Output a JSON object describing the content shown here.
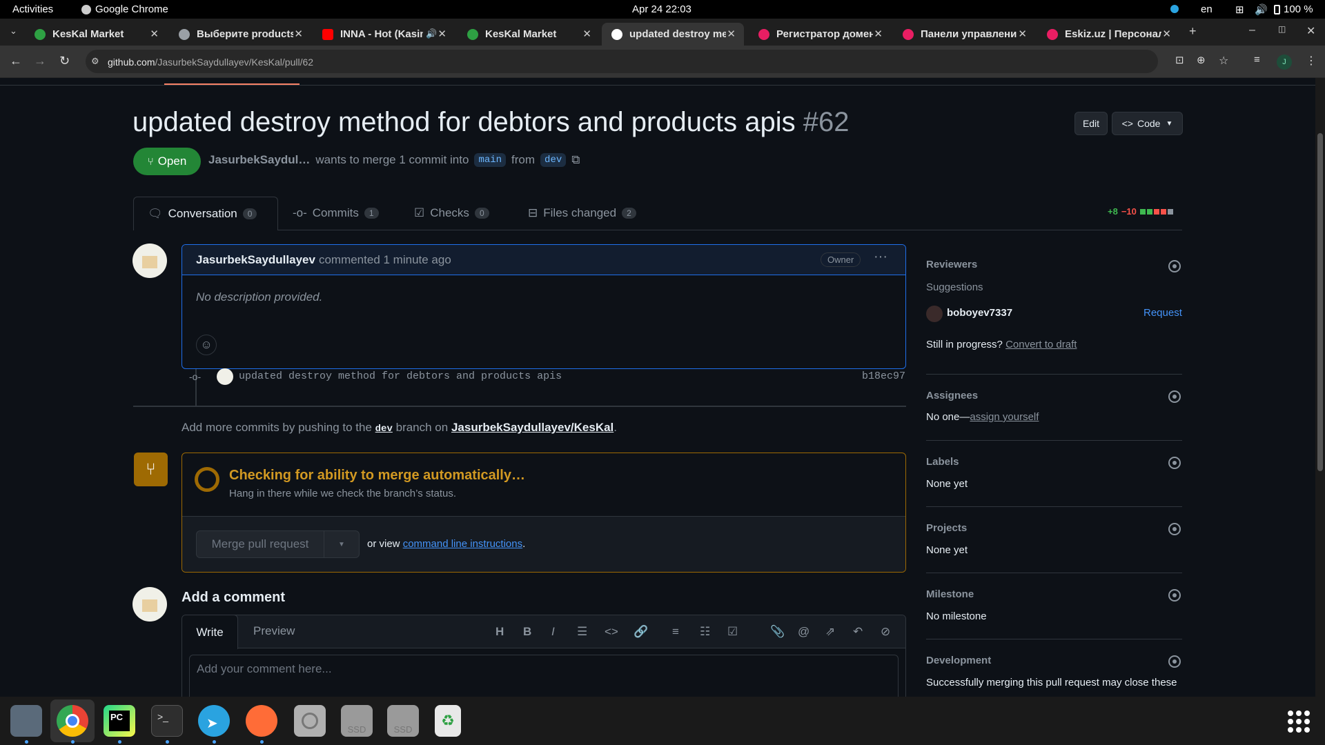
{
  "system": {
    "activities": "Activities",
    "app_name": "Google Chrome",
    "clock": "Apr 24  22:03",
    "lang": "en",
    "battery": "100 %"
  },
  "tabs": [
    {
      "title": "KesKal Market",
      "color": "#2ea043"
    },
    {
      "title": "Выберите products",
      "color": "#9aa0a6"
    },
    {
      "title": "INNA - Hot (Kasin",
      "color": "#ff0000"
    },
    {
      "title": "KesKal Market",
      "color": "#2ea043"
    },
    {
      "title": "updated destroy me",
      "color": "#ffffff"
    },
    {
      "title": "Регистратор домен",
      "color": "#e91e63"
    },
    {
      "title": "Панели управлени",
      "color": "#e91e63"
    },
    {
      "title": "Eskiz.uz | Персонал",
      "color": "#e91e63"
    }
  ],
  "address": {
    "url_host": "github.com",
    "url_path": "/JasurbekSaydullayev/KesKal/pull/62"
  },
  "pr": {
    "title": "updated destroy method for debtors and products apis",
    "number": "#62",
    "edit_label": "Edit",
    "code_label": "Code",
    "state": "Open",
    "author": "JasurbekSaydul…",
    "merge_text": "wants to merge 1 commit into",
    "base_branch": "main",
    "from_text": "from",
    "head_branch": "dev",
    "diff_add": "+8",
    "diff_del": "−10"
  },
  "pr_tabs": [
    {
      "label": "Conversation",
      "count": "0"
    },
    {
      "label": "Commits",
      "count": "1"
    },
    {
      "label": "Checks",
      "count": "0"
    },
    {
      "label": "Files changed",
      "count": "2"
    }
  ],
  "comment": {
    "author": "JasurbekSaydullayev",
    "meta": "commented 1 minute ago",
    "role": "Owner",
    "body": "No description provided."
  },
  "commit": {
    "message": "updated destroy method for debtors and products apis",
    "sha": "b18ec97"
  },
  "push_hint": {
    "prefix": "Add more commits by pushing to the",
    "branch": "dev",
    "middle": "branch on",
    "repo": "JasurbekSaydullayev/KesKal",
    "suffix": "."
  },
  "merge": {
    "title": "Checking for ability to merge automatically…",
    "subtitle": "Hang in there while we check the branch’s status.",
    "button": "Merge pull request",
    "or_view": "or view",
    "cli_link": "command line instructions",
    "period": "."
  },
  "add_comment": {
    "heading": "Add a comment",
    "write_tab": "Write",
    "preview_tab": "Preview",
    "placeholder": "Add your comment here..."
  },
  "sidebar": {
    "reviewers": {
      "heading": "Reviewers",
      "suggestions": "Suggestions",
      "user": "boboyev7337",
      "request": "Request",
      "still": "Still in progress?",
      "draft": "Convert to draft"
    },
    "assignees": {
      "heading": "Assignees",
      "value": "No one—",
      "link": "assign yourself"
    },
    "labels": {
      "heading": "Labels",
      "value": "None yet"
    },
    "projects": {
      "heading": "Projects",
      "value": "None yet"
    },
    "milestone": {
      "heading": "Milestone",
      "value": "No milestone"
    },
    "development": {
      "heading": "Development",
      "value": "Successfully merging this pull request may close these"
    }
  },
  "dock": {
    "ssd1": "SSD",
    "ssd2": "SSD"
  },
  "colors": {
    "open_green": "#238636",
    "accent_blue": "#4493f8",
    "merge_pending": "#d29922"
  }
}
